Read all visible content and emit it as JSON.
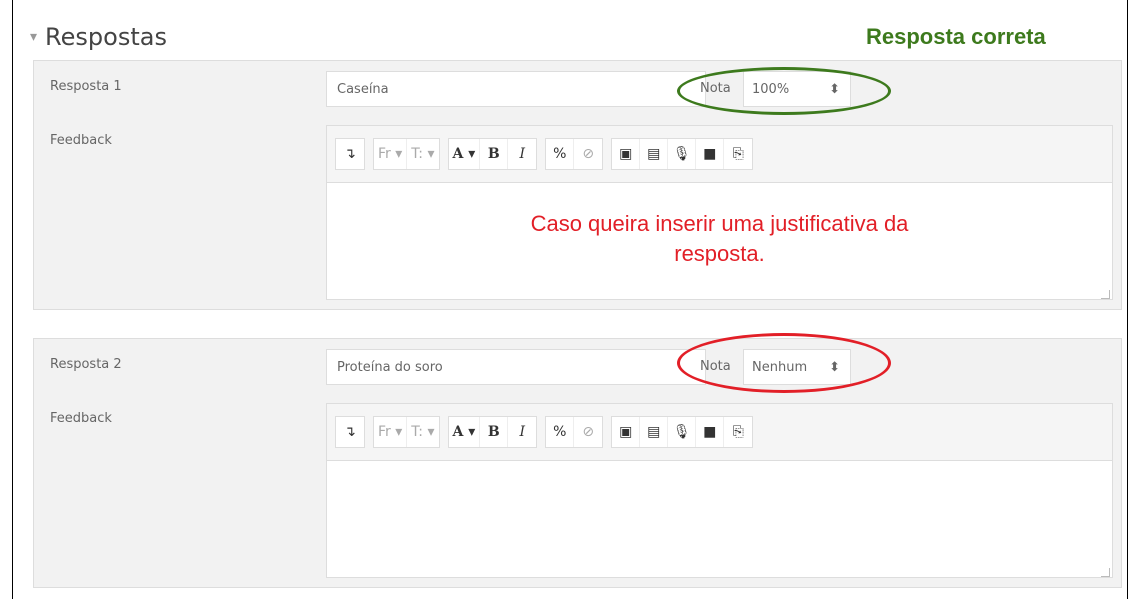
{
  "section": {
    "title": "Respostas",
    "collapse_icon": "chevron-down-icon"
  },
  "annotation": {
    "correct_label": "Resposta correta",
    "correct_color": "#3d7a1d",
    "wrong_color": "#e21f27"
  },
  "toolbar": {
    "expand": "↴",
    "font_family": "Fr ▾",
    "font_size": "T: ▾",
    "color": "A ▾",
    "bold": "B",
    "italic": "I",
    "link": "%",
    "unlink": "⊘",
    "image": "▣",
    "media": "▤",
    "record_audio": "🎙",
    "record_video": "■",
    "manage_files": "⎘"
  },
  "answers": [
    {
      "label": "Resposta 1",
      "value": "Caseína",
      "grade_label": "Nota",
      "grade_value": "100%",
      "feedback_label": "Feedback",
      "feedback_note_line1": "Caso queira inserir uma justificativa da",
      "feedback_note_line2": "resposta."
    },
    {
      "label": "Resposta 2",
      "value": "Proteína do soro",
      "grade_label": "Nota",
      "grade_value": "Nenhum",
      "feedback_label": "Feedback"
    }
  ]
}
